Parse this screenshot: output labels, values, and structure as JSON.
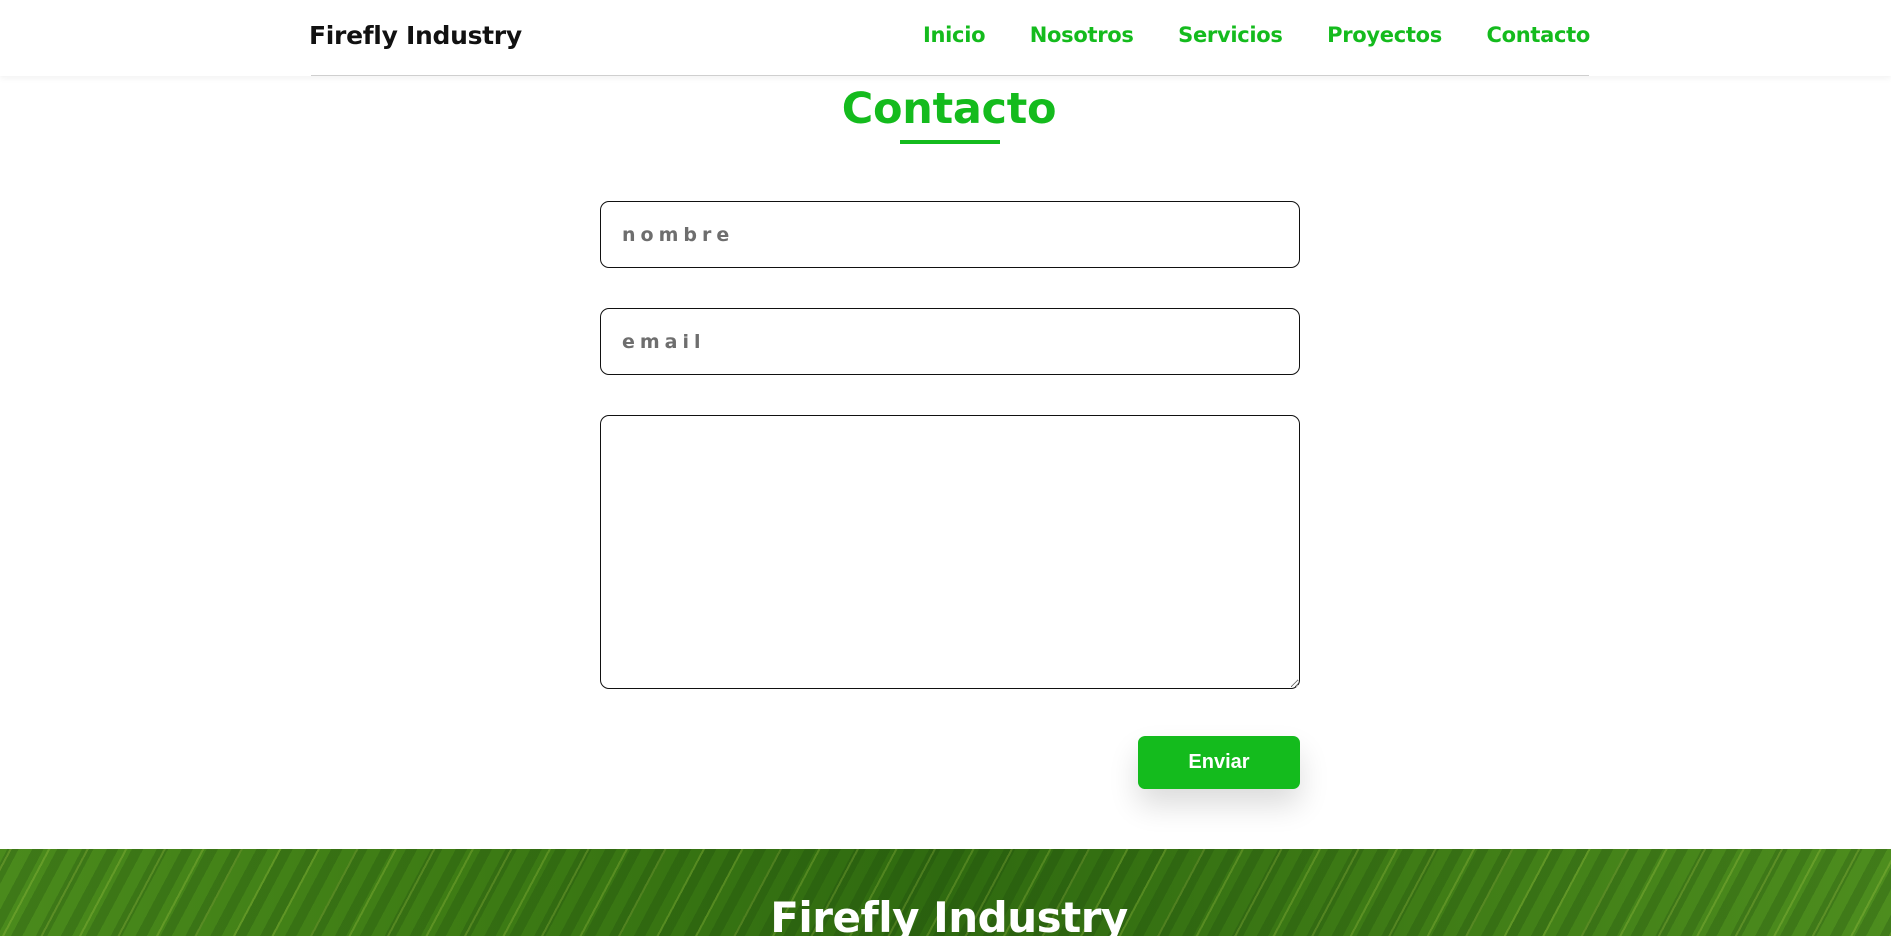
{
  "header": {
    "brand": "Firefly Industry",
    "nav": [
      "Inicio",
      "Nosotros",
      "Servicios",
      "Proyectos",
      "Contacto"
    ]
  },
  "contact": {
    "title": "Contacto",
    "name_placeholder": "nombre",
    "email_placeholder": "email",
    "message_value": "",
    "submit_label": "Enviar"
  },
  "footer": {
    "title": "Firefly Industry"
  },
  "colors": {
    "accent": "#14bb1d",
    "text": "#111111",
    "placeholder": "#6e6e6e"
  }
}
